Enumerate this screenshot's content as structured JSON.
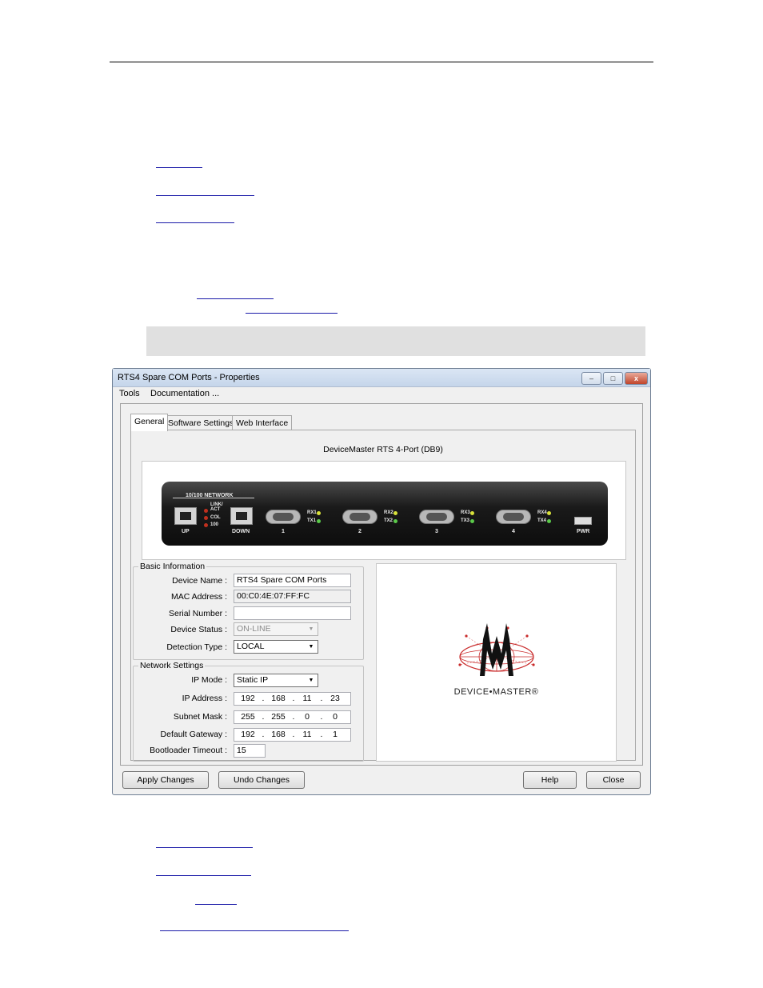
{
  "window": {
    "title": "RTS4 Spare COM Ports - Properties",
    "controls": {
      "minimize": "–",
      "maximize": "□",
      "close": "x"
    }
  },
  "menu": [
    "Tools",
    "Documentation ..."
  ],
  "tabs": [
    "General",
    "Software Settings",
    "Web Interface"
  ],
  "device_title": "DeviceMaster RTS 4-Port (DB9)",
  "device_photo": {
    "network_label": "10/100 NETWORK",
    "port_up": "UP",
    "port_down": "DOWN",
    "leds": [
      "LINK/ ACT",
      "COL",
      "100"
    ],
    "serial_ports": [
      "1",
      "2",
      "3",
      "4"
    ],
    "rx_labels": [
      "RX1",
      "RX2",
      "RX3",
      "RX4"
    ],
    "tx_labels": [
      "TX1",
      "TX2",
      "TX3",
      "TX4"
    ],
    "power": "PWR"
  },
  "basic_info": {
    "title": "Basic Information",
    "device_name_label": "Device Name :",
    "device_name": "RTS4 Spare COM Ports",
    "mac_label": "MAC Address :",
    "mac": "00:C0:4E:07:FF:FC",
    "serial_label": "Serial Number :",
    "serial": "",
    "status_label": "Device Status :",
    "status": "ON-LINE",
    "detection_label": "Detection Type :",
    "detection": "LOCAL"
  },
  "network": {
    "title": "Network Settings",
    "ip_mode_label": "IP Mode :",
    "ip_mode": "Static IP",
    "ip_label": "IP Address :",
    "ip": [
      "192",
      "168",
      "11",
      "23"
    ],
    "subnet_label": "Subnet Mask :",
    "subnet": [
      "255",
      "255",
      "0",
      "0"
    ],
    "gateway_label": "Default Gateway :",
    "gateway": [
      "192",
      "168",
      "11",
      "1"
    ],
    "bootloader_label": "Bootloader Timeout :",
    "bootloader": "15"
  },
  "logo": {
    "text": "DEVICE•MASTER®"
  },
  "buttons": {
    "apply": "Apply Changes",
    "undo": "Undo Changes",
    "help": "Help",
    "close": "Close"
  }
}
